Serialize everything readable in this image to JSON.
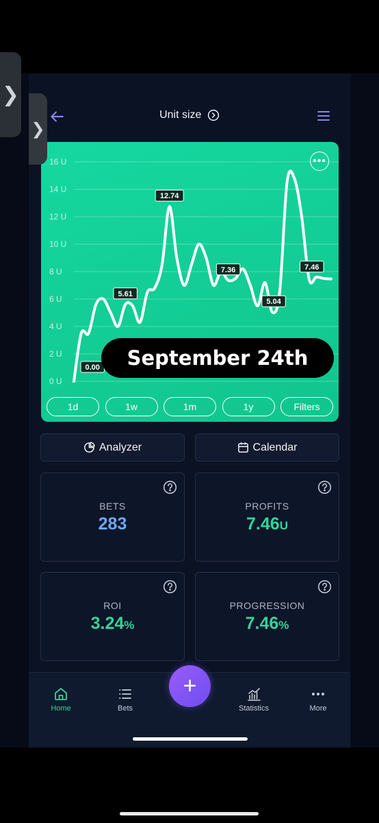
{
  "header": {
    "title": "Unit size"
  },
  "chart_data": {
    "type": "line",
    "y_ticks": [
      "16 U",
      "14 U",
      "12 U",
      "10 U",
      "8 U",
      "6 U",
      "4 U",
      "2 U",
      "0 U"
    ],
    "ylim": [
      0,
      16
    ],
    "x": [
      0,
      1,
      2,
      3,
      4,
      5,
      6,
      7,
      8,
      9,
      10,
      11,
      12,
      13,
      14,
      15,
      16,
      17,
      18,
      19,
      20,
      21,
      22,
      23,
      24,
      25,
      26,
      27,
      28,
      29,
      30,
      31,
      32,
      33,
      34,
      35
    ],
    "values": [
      0.0,
      3.5,
      3.5,
      5.6,
      6.0,
      5.0,
      4.0,
      5.61,
      5.5,
      4.3,
      6.5,
      6.8,
      8.5,
      12.74,
      9.0,
      7.0,
      8.5,
      10.0,
      9.0,
      7.0,
      8.0,
      7.36,
      7.5,
      8.2,
      7.0,
      5.5,
      7.2,
      5.04,
      6.5,
      14.5,
      14.8,
      12.0,
      7.46,
      7.6,
      7.5,
      7.46
    ],
    "data_labels": [
      {
        "index": 0,
        "text": "0.00"
      },
      {
        "index": 7,
        "text": "5.61"
      },
      {
        "index": 13,
        "text": "12.74"
      },
      {
        "index": 21,
        "text": "7.36"
      },
      {
        "index": 27,
        "text": "5.04"
      },
      {
        "index": 32,
        "text": "7.46"
      }
    ],
    "grid": true,
    "line_color": "#ffffff",
    "background": "#14d39b"
  },
  "overlay": {
    "date_text": "September 24th"
  },
  "ranges": [
    "1d",
    "1w",
    "1m",
    "1y",
    "Filters"
  ],
  "actions": {
    "analyzer": "Analyzer",
    "calendar": "Calendar"
  },
  "stats": {
    "bets": {
      "label": "BETS",
      "value": "283"
    },
    "profits": {
      "label": "PROFITS",
      "value": "7.46",
      "unit": "U"
    },
    "roi": {
      "label": "ROI",
      "value": "3.24",
      "unit": "%"
    },
    "progression": {
      "label": "PROGRESSION",
      "value": "7.46",
      "unit": "%"
    }
  },
  "nav": {
    "home": "Home",
    "bets": "Bets",
    "add": "+",
    "statistics": "Statistics",
    "more": "More"
  },
  "colors": {
    "accent_green": "#2fd69b",
    "accent_blue": "#6ea7f4",
    "accent_purple": "#8b83e8"
  }
}
